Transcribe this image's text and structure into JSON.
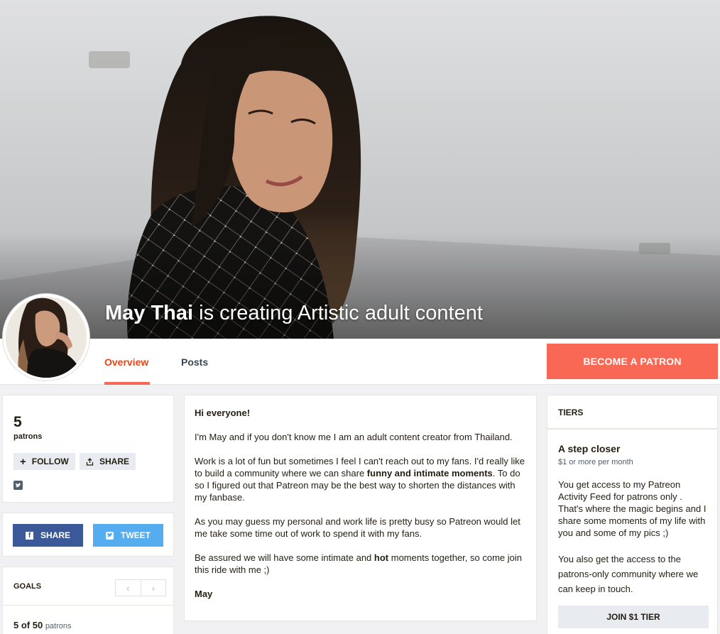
{
  "hero": {
    "creator_name": "May Thai",
    "tagline": " is creating Artistic adult content"
  },
  "nav": {
    "tabs": [
      {
        "label": "Overview",
        "active": true
      },
      {
        "label": "Posts",
        "active": false
      }
    ],
    "become_patron": "BECOME A PATRON"
  },
  "stats": {
    "patron_count": "5",
    "patron_label": "patrons",
    "follow_label": "FOLLOW",
    "share_label": "SHARE"
  },
  "share_buttons": {
    "facebook": "SHARE",
    "twitter": "TWEET"
  },
  "goals": {
    "heading": "GOALS",
    "progress_count": "5 of 50",
    "progress_unit": "patrons"
  },
  "about": {
    "greeting": "Hi everyone!",
    "p1": "I'm May and if you don't know me I am an adult content creator from Thailand.",
    "p2_start": "Work is a lot of fun but sometimes I feel I can't reach out to my fans. I'd really like to build a community where we can share ",
    "p2_bold": "funny and intimate moments",
    "p2_end": ". To do so I figured out that Patreon may be the best way to shorten the distances with my fanbase.",
    "p3": "As you may guess my personal and work life is pretty busy so Patreon would let me take some time out of work to spend it with my fans.",
    "p4_start": "Be assured we will have some intimate and ",
    "p4_bold": "hot",
    "p4_end": " moments together, so come join this ride with me ;)",
    "signature": "May"
  },
  "tiers": {
    "heading": "TIERS",
    "items": [
      {
        "title": "A step closer",
        "price": "$1 or more per month",
        "desc1": "You get access to my Patreon Activity Feed for patrons only . That's where the magic begins and I share some moments of my life with you and some of my pics ;)",
        "desc2": "You also get the access to the patrons-only community where we can keep in touch.",
        "join_label": "JOIN $1 TIER"
      }
    ]
  },
  "colors": {
    "accent": "#f96854",
    "facebook": "#3b5998",
    "twitter": "#55acee"
  }
}
